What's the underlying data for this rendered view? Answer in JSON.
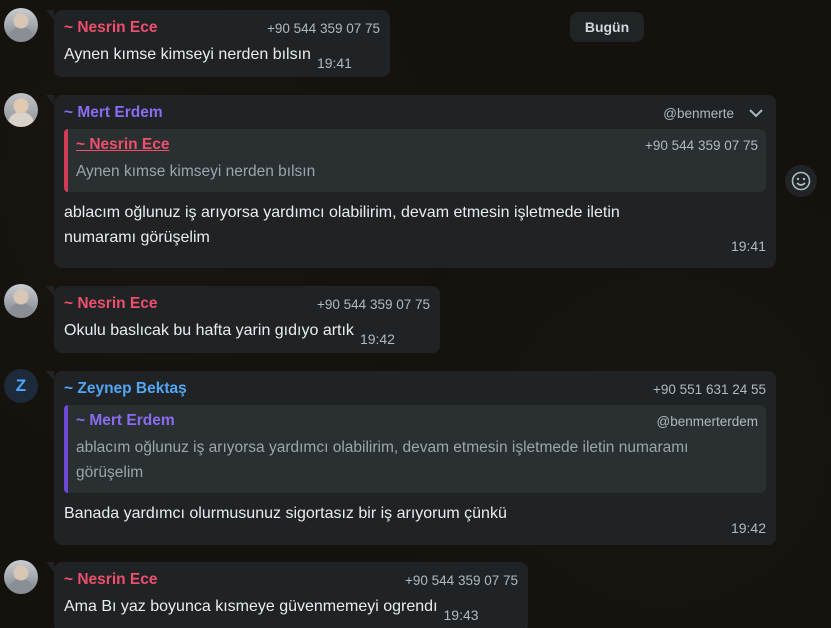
{
  "date_chip": "Bugün",
  "messages": [
    {
      "sender": "~ Nesrin Ece",
      "phone": "+90 544 359 07 75",
      "text": "Aynen kımse kimseyi nerden bılsın",
      "time": "19:41"
    },
    {
      "sender": "~ Mert Erdem",
      "phone": "@benmerte",
      "quote": {
        "sender": "~ Nesrin Ece",
        "phone": "+90 544 359 07 75",
        "text": "Aynen kımse kimseyi nerden bılsın"
      },
      "text_line1": "ablacım oğlunuz iş arıyorsa yardımcı olabilirim, devam etmesin işletmede iletin",
      "text_line2": "numaramı görüşelim",
      "time": "19:41"
    },
    {
      "sender": "~ Nesrin Ece",
      "phone": "+90 544 359 07 75",
      "text": "Okulu baslıcak bu hafta yarin gıdıyo artık",
      "time": "19:42"
    },
    {
      "avatar_letter": "Z",
      "sender": "~ Zeynep Bektaş",
      "phone": "+90 551 631 24 55",
      "quote": {
        "sender": "~ Mert Erdem",
        "phone": "@benmerterdem",
        "text_line1": "ablacım oğlunuz iş arıyorsa yardımcı olabilirim, devam etmesin işletmede iletin numaramı",
        "text_line2": "görüşelim"
      },
      "text": "Banada yardımcı olurmusunuz sigortasız bir iş arıyorum çünkü",
      "time": "19:42"
    },
    {
      "sender": "~ Nesrin Ece",
      "phone": "+90 544 359 07 75",
      "text": "Ama Bı yaz boyunca kısmeye güvenmemeyi ogrendı",
      "time": "19:43"
    }
  ],
  "icons": {
    "chevron": "chevron-down-icon",
    "emoji": "emoji-icon"
  },
  "colors": {
    "nesrin": "#ef4f6b",
    "mert": "#8b6cf0",
    "zeynep": "#53a6f5",
    "bubble": "#1f2326",
    "quote": "#2a2f32"
  }
}
